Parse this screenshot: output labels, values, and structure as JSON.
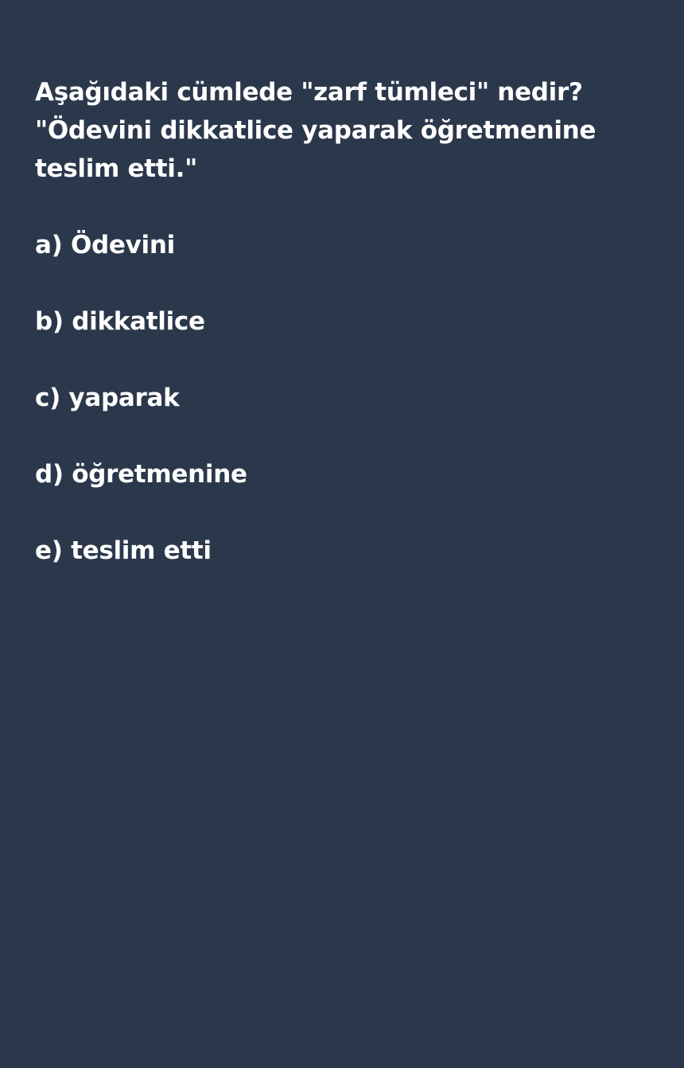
{
  "question": {
    "lines": [
      "Aşağıdaki cümlede \"zarf tümleci\" nedir?",
      "\"Ödevini dikkatlice yaparak öğretmenine",
      "teslim etti.\""
    ]
  },
  "options": [
    "a) Ödevini",
    "b) dikkatlice",
    "c) yaparak",
    "d) öğretmenine",
    "e) teslim etti"
  ],
  "colors": {
    "background": "#2b384c",
    "text": "#ffffff"
  }
}
